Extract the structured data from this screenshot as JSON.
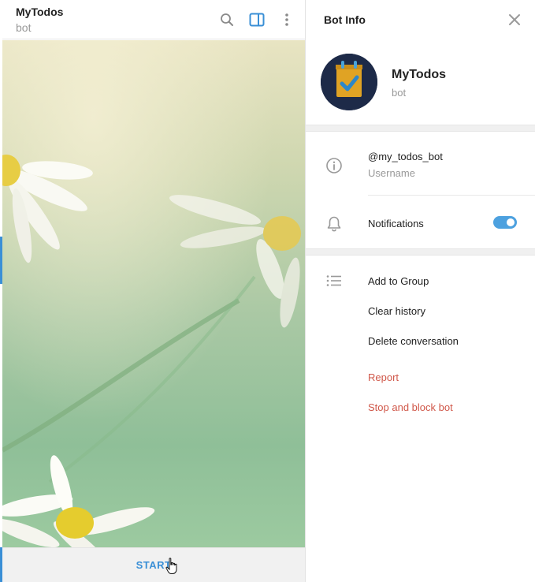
{
  "chat": {
    "title": "MyTodos",
    "status": "bot",
    "start_label": "START"
  },
  "header_icons": [
    "search-icon",
    "side-panel-icon",
    "more-vertical-icon"
  ],
  "info_panel": {
    "title": "Bot Info",
    "bot_name": "MyTodos",
    "bot_subtitle": "bot",
    "username": "@my_todos_bot",
    "username_label": "Username",
    "notifications_label": "Notifications",
    "notifications_on": true,
    "actions": {
      "add_to_group": "Add to Group",
      "clear_history": "Clear history",
      "delete_conversation": "Delete conversation",
      "report": "Report",
      "stop_block": "Stop and block bot"
    }
  },
  "colors": {
    "accent": "#3a8fd6",
    "danger": "#d0584a",
    "toggle_on": "#4da1df",
    "avatar_bg": "#1d2a48",
    "avatar_icon": "#e0a324"
  }
}
